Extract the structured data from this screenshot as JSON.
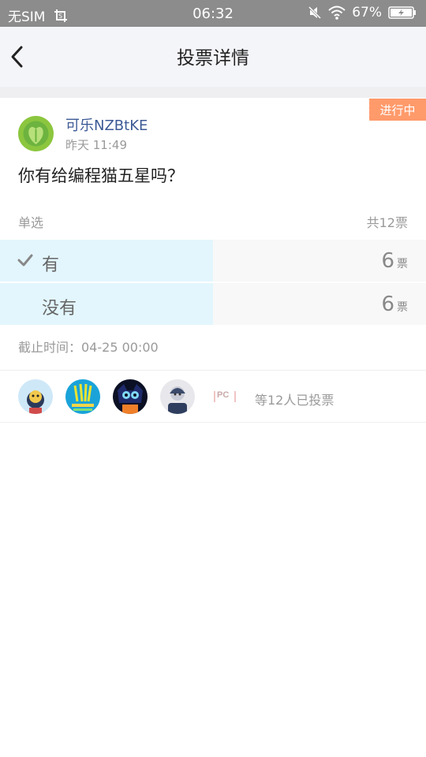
{
  "status_bar": {
    "carrier": "无SIM",
    "time": "06:32",
    "battery": "67%",
    "icons": [
      "screenshot-icon",
      "mute-icon",
      "wifi-icon",
      "battery-icon"
    ]
  },
  "header": {
    "title": "投票详情",
    "back_icon": "chevron-left-icon"
  },
  "poll": {
    "status": "进行中",
    "author": {
      "name": "可乐NZBtKE",
      "time": "昨天 11:49"
    },
    "question": "你有给编程猫五星吗？",
    "type_label": "单选",
    "total_label": "共12票",
    "options": [
      {
        "label": "有",
        "count": "6",
        "unit": "票",
        "selected": true,
        "share": 0.5
      },
      {
        "label": "没有",
        "count": "6",
        "unit": "票",
        "selected": false,
        "share": 0.5
      }
    ],
    "deadline": "截止时间：04-25 00:00"
  },
  "voters": {
    "summary": "等12人已投票",
    "badge_text": "PC"
  },
  "colors": {
    "accent_tag": "#ff9a6b",
    "name_blue": "#3d5a96",
    "option_fill": "#e3f6fd"
  }
}
